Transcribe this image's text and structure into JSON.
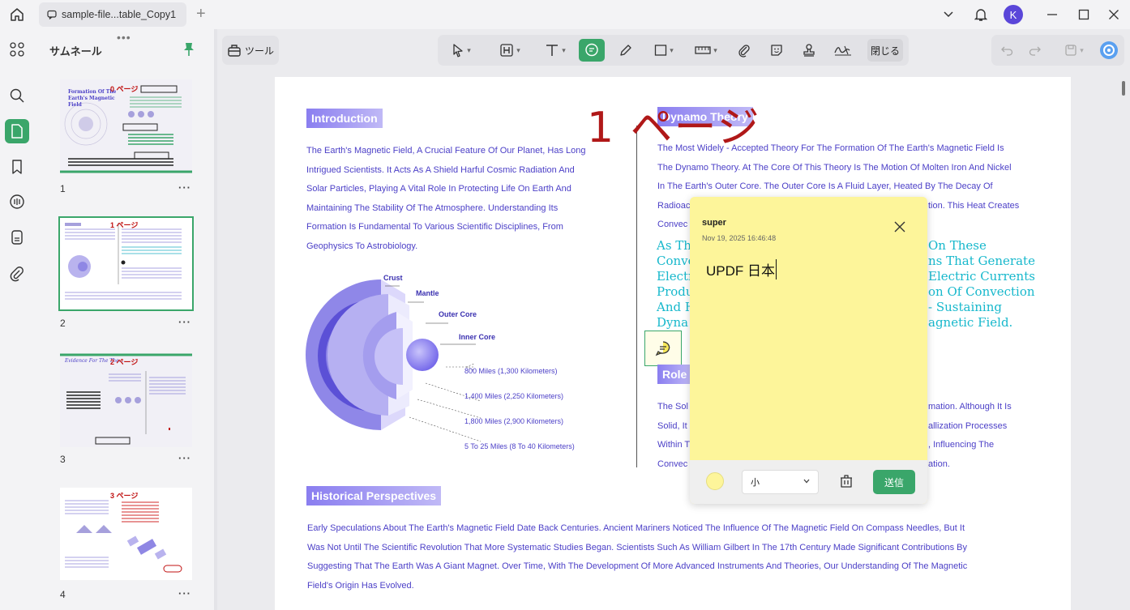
{
  "titlebar": {
    "tab_title": "sample-file...table_Copy1",
    "avatar_initial": "K"
  },
  "thumbnail_panel": {
    "title": "サムネール",
    "pages": [
      {
        "number": "1",
        "label": "0 ページ"
      },
      {
        "number": "2",
        "label": "1 ページ"
      },
      {
        "number": "3",
        "label": "2 ページ"
      },
      {
        "number": "4",
        "label": "3 ページ"
      }
    ],
    "page1_title": "Formation Of The Earth's Magnetic Field",
    "page3_title": "Evidence For The The..."
  },
  "toolbar": {
    "tools_label": "ツール",
    "close_label": "閉じる"
  },
  "document": {
    "page_label": "1 ページ",
    "intro_heading": "Introduction",
    "intro_text": [
      "The Earth's Magnetic Field, A Crucial Feature Of Our Planet, Has Long",
      "Intrigued Scientists. It Acts As A Shield Harful Cosmic Radiation And",
      "Solar Particles, Playing A Vital Role In Protecting Life On Earth And",
      "Maintaining The Stability Of The Atmosphere. Understanding Its",
      "Formation Is Fundamental To Various Scientific Disciplines, From",
      "Geophysics To Astrobiology."
    ],
    "dynamo_heading": "Dynamo Theory",
    "dynamo_text": [
      "The Most Widely - Accepted Theory For The Formation Of The Earth's Magnetic Field Is",
      "The Dynamo Theory. At The Core Of This Theory Is The Motion Of Molten Iron And Nickel",
      "In The Earth's Outer Core. The Outer Core Is A Fluid Layer, Heated By The Decay Of",
      "Radioac",
      "Convec"
    ],
    "dynamo_text_right": [
      "tion. This Heat Creates"
    ],
    "serif_left": [
      "As Th",
      "Conve",
      "Electr",
      "Produ",
      "And H",
      "Dyna"
    ],
    "serif_right": [
      "On These",
      "ns That Generate",
      "Electric Currents",
      "on Of Convection",
      "- Sustaining",
      "agnetic Field."
    ],
    "role_heading": "Role",
    "role_left": [
      "The Sol",
      "Solid, It",
      "Within T",
      "Convec"
    ],
    "role_right": [
      "mation. Although It Is",
      "allization Processes",
      ", Influencing The",
      "ation."
    ],
    "earth_labels": {
      "crust": "Crust",
      "mantle": "Mantle",
      "outer_core": "Outer Core",
      "inner_core": "Inner Core"
    },
    "distances": [
      "800 Miles (1,300 Kilometers)",
      "1,400 Miles (2,250 Kilometers)",
      "1,800 Miles (2,900 Kilometers)",
      "5 To 25 Miles (8 To 40 Kilometers)"
    ],
    "historical_heading": "Historical Perspectives",
    "historical_text": [
      "Early Speculations About The Earth's Magnetic Field Date Back Centuries. Ancient Mariners Noticed The Influence Of The Magnetic Field On Compass Needles, But It",
      "Was Not Until The Scientific Revolution That More Systematic Studies Began. Scientists Such As William Gilbert In The 17th Century Made Significant Contributions By",
      "Suggesting That The Earth Was A Giant Magnet. Over Time, With The Development Of More Advanced Instruments And Theories, Our Understanding Of The Magnetic",
      "Field's Origin Has Evolved."
    ]
  },
  "note": {
    "author": "super",
    "date": "Nov 19, 2025 16:46:48",
    "text": "UPDF 日本",
    "size_option": "小",
    "send_label": "送信",
    "color": "#fdf59a"
  },
  "colors": {
    "accent": "#3aa66a",
    "body_text": "#4b3fc7",
    "serif_text": "#17b8cc",
    "page_label": "#b01818"
  }
}
